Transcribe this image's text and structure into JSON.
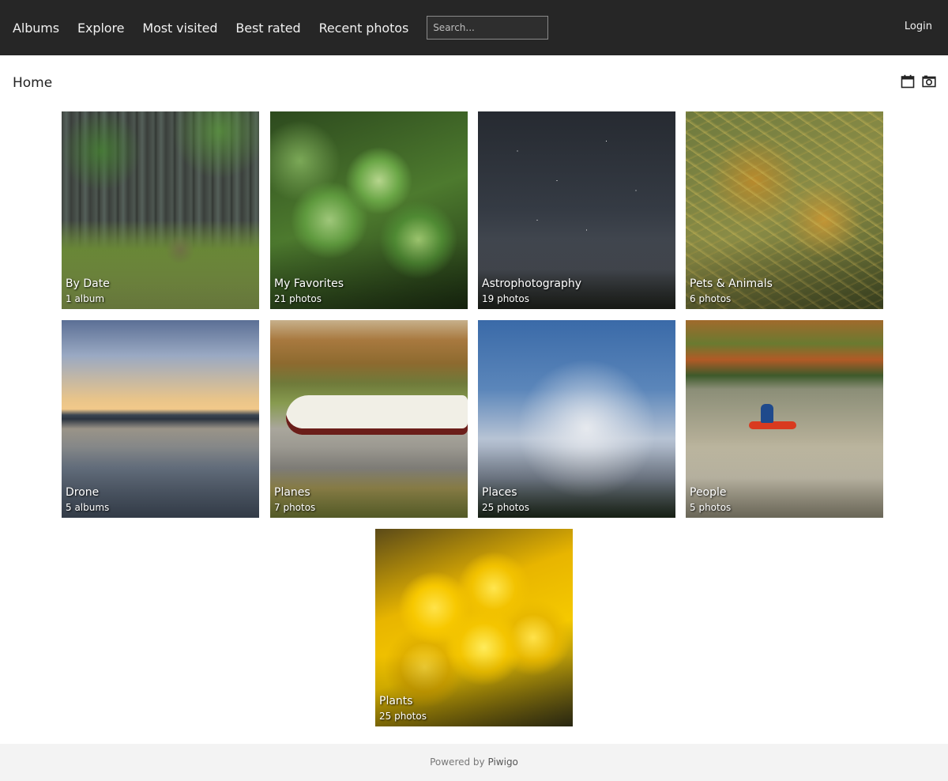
{
  "nav": {
    "items": [
      "Albums",
      "Explore",
      "Most visited",
      "Best rated",
      "Recent photos"
    ],
    "search_placeholder": "Search...",
    "login": "Login"
  },
  "breadcrumb": {
    "home": "Home"
  },
  "toolbar": {
    "icons": [
      "calendar-icon",
      "camera-icon"
    ]
  },
  "albums": [
    {
      "name": "By Date",
      "count": "1 album"
    },
    {
      "name": "My Favorites",
      "count": "21 photos"
    },
    {
      "name": "Astrophotography",
      "count": "19 photos"
    },
    {
      "name": "Pets & Animals",
      "count": "6 photos"
    },
    {
      "name": "Drone",
      "count": "5 albums"
    },
    {
      "name": "Planes",
      "count": "7 photos"
    },
    {
      "name": "Places",
      "count": "25 photos"
    },
    {
      "name": "People",
      "count": "5 photos"
    },
    {
      "name": "Plants",
      "count": "25 photos"
    }
  ],
  "footer": {
    "powered_by": "Powered by",
    "piwigo": "Piwigo"
  }
}
